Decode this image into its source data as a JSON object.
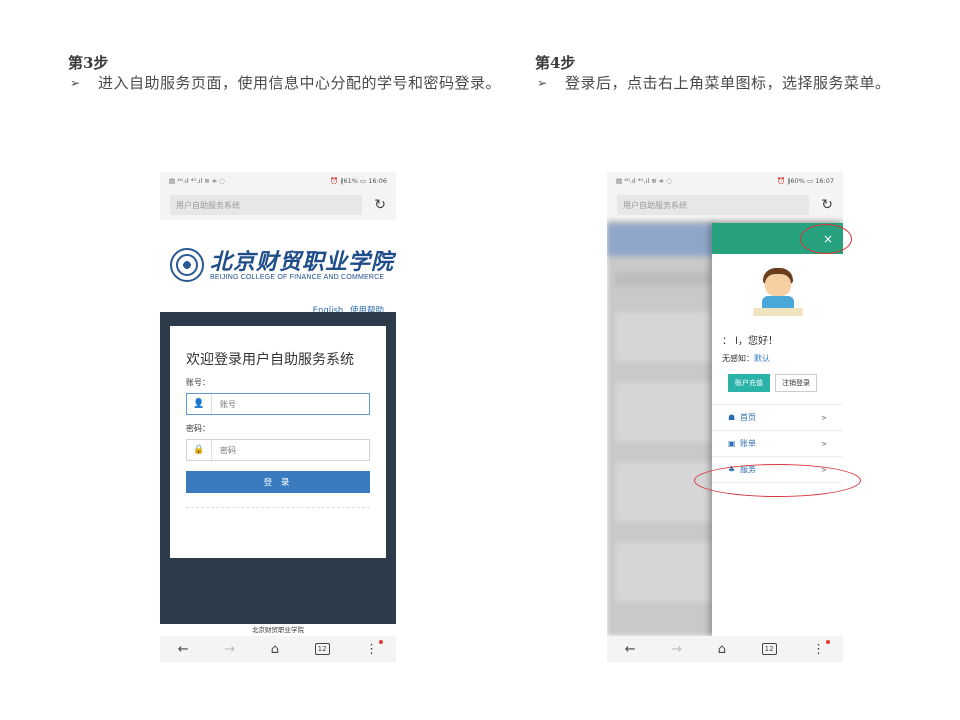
{
  "step3": {
    "title": "第3步",
    "bullet": "➢",
    "text": "进入自助服务页面，使用信息中心分配的学号和密码登录。"
  },
  "step4": {
    "title": "第4步",
    "bullet": "➢",
    "text": "登录后，点击右上角菜单图标，选择服务菜单。"
  },
  "phone1": {
    "status_left": "▤ ⁴ᴳ.ıl ⁴ᴳ.ıl ≋ ≑ ◌",
    "status_right": "⏰ ∦61% ▭ 16:06",
    "address": "用户自助服务系统",
    "reload_icon": "↻",
    "logo_cn": "北京财贸职业学院",
    "logo_en": "BEIJING COLLEGE OF FINANCE AND COMMERCE",
    "link_english": "English",
    "link_help": "使用帮助",
    "login_title": "欢迎登录用户自助服务系统",
    "account_label": "账号：",
    "account_placeholder": "账号",
    "password_label": "密码：",
    "password_placeholder": "密码",
    "login_button": "登 录",
    "footer": "北京财贸职业学院"
  },
  "phone2": {
    "status_left": "▤ ⁴ᴳ.ıl ⁴ᴳ.ıl ≋ ≑ ◌",
    "status_right": "⏰ ∦60% ▭ 16:07",
    "address": "用户自助服务系统",
    "reload_icon": "↻",
    "close_icon": "×",
    "greeting": "：  l，您好！",
    "notice_label": "无感知：",
    "notice_value": "默认",
    "recharge_button": "账户充值",
    "logout_button": "注销登录",
    "menu": [
      {
        "icon": "☗",
        "label": "首页",
        "arrow": ">"
      },
      {
        "icon": "▣",
        "label": "账单",
        "arrow": ">"
      },
      {
        "icon": "♣",
        "label": "服务",
        "arrow": ">"
      }
    ]
  },
  "navbar": {
    "back": "←",
    "forward": "→",
    "home": "⌂",
    "tabs": "12",
    "more": "⋮"
  },
  "colors": {
    "accent_green": "#27a17e",
    "accent_teal": "#2bb3a9",
    "login_blue": "#3a7bbf",
    "dark_panel": "#2c3a4a",
    "annotation_red": "#d9363e"
  }
}
